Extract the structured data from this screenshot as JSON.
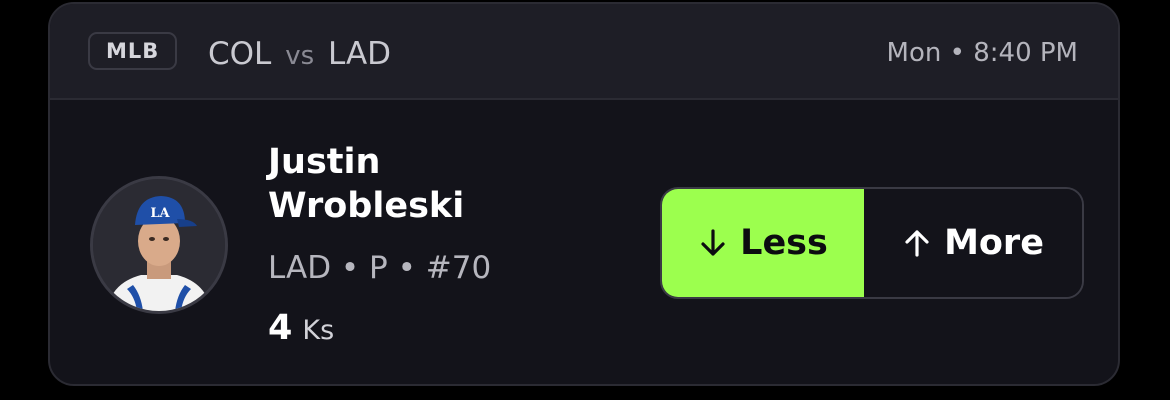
{
  "header": {
    "league": "MLB",
    "away_team": "COL",
    "vs": "vs",
    "home_team": "LAD",
    "game_time": "Mon • 8:40 PM"
  },
  "player": {
    "name": "Justin Wrobleski",
    "meta": "LAD • P • #70",
    "projection_value": "4",
    "projection_unit": "Ks"
  },
  "picks": {
    "less_label": "Less",
    "more_label": "More",
    "selected": "less",
    "less_icon": "arrow-down-icon",
    "more_icon": "arrow-up-icon"
  },
  "colors": {
    "accent": "#9cff4e",
    "card_bg": "#13131a",
    "header_bg": "#1e1e26",
    "team_cap": "#1f4fa8"
  }
}
